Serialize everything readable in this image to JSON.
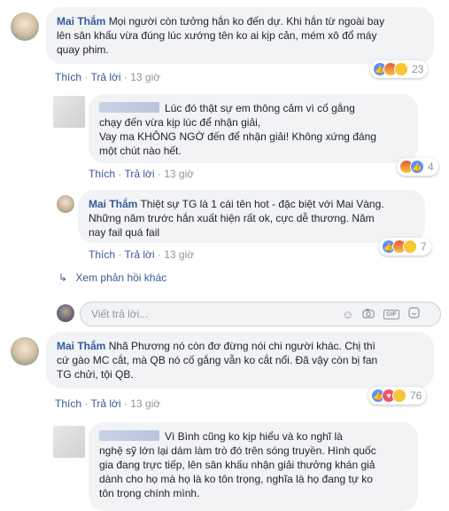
{
  "comments": [
    {
      "author": "Mai Thắm",
      "line1": "Mọi người còn tưởng hắn ko đến dự. Khi hắn từ ngoài bay",
      "line2": "lên sân khấu vừa đúng lúc xướng tên ko ai kịp cản, mém xô đổ máy",
      "line3": "quay phim.",
      "like": "Thích",
      "reply": "Trả lời",
      "time": "13 giờ",
      "reaction_count": "23"
    },
    {
      "line1": "Lúc đó thật sự em thông cảm vì cố gắng",
      "line2": "chạy đến vừa kịp lúc để nhận giải,",
      "line3": "Vay ma KHÔNG NGỜ đến để nhận giải! Không xứng đáng",
      "line4": "một chút nào hết.",
      "like": "Thích",
      "reply": "Trả lời",
      "time": "13 giờ",
      "reaction_count": "4"
    },
    {
      "author": "Mai Thắm",
      "line1": "Thiệt sự TG là 1 cái tên hot - đặc biệt với Mai Vàng.",
      "line2": "Những năm trước hắn xuất hiện rất ok, cực dễ thương. Năm",
      "line3": "nay fail quá fail",
      "like": "Thích",
      "reply": "Trả lời",
      "time": "13 giờ",
      "reaction_count": "7"
    },
    {
      "author": "Mai Thắm",
      "line1": "Nhã Phương nó còn đơ đừng nói chi người khác. Chị thì",
      "line2": "cứ gào MC cắt, mà QB nó cố gắng vẫn ko cắt nổi. Đã vậy còn bị fan",
      "line3": "TG chửi, tội QB.",
      "like": "Thích",
      "reply": "Trả lời",
      "time": "13 giờ",
      "reaction_count": "76"
    },
    {
      "line1": "Vì Bình cũng ko kịp hiểu và ko nghĩ là",
      "line2": "nghệ sỹ lớn lại dám làm trò đó trên sóng truyền. Hình quốc",
      "line3": "gia đang trực tiếp, lên sân khấu nhận giải thưởng khán giả",
      "line4": "dành cho họ mà họ là ko tôn trọng, nghĩa là họ đang tự ko",
      "line5": "tôn trọng chính mình."
    }
  ],
  "more_replies": "Xem phản hồi khác",
  "reply_box": {
    "placeholder": "Viết trả lời..."
  },
  "icons": [
    "reply-arrow-icon",
    "emoji-icon",
    "camera-icon",
    "gif-icon",
    "sticker-icon"
  ],
  "colors": {
    "link": "#365899",
    "bubble": "#f2f3f5",
    "meta": "#90949c"
  }
}
